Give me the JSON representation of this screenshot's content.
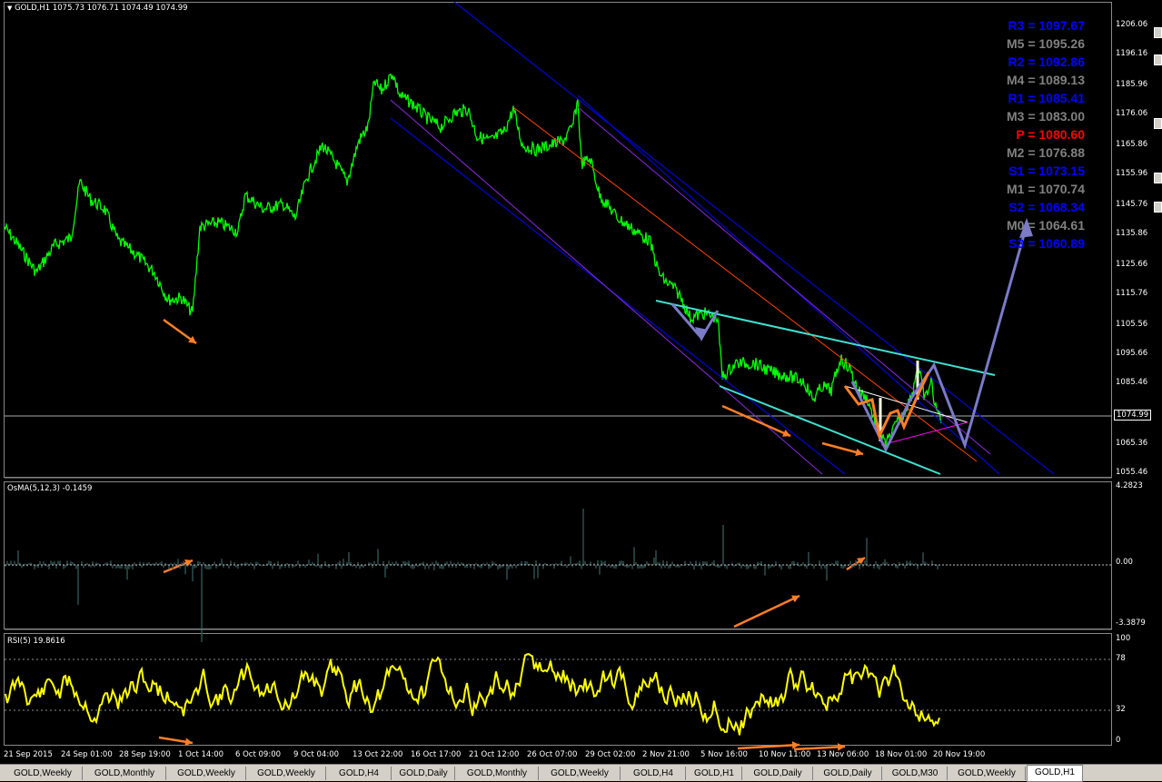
{
  "price_pane": {
    "title": "GOLD,H1  1075.73 1076.71 1074.49 1074.99",
    "current_price": "1074.99",
    "y_labels": [
      "1206.06",
      "1196.16",
      "1185.96",
      "1176.06",
      "1165.86",
      "1155.96",
      "1145.76",
      "1135.86",
      "1125.66",
      "1115.76",
      "1105.56",
      "1095.66",
      "1085.46",
      "1065.36",
      "1055.46"
    ],
    "pivots": [
      {
        "label": "R3 = 1097.67",
        "color": "#0000ff"
      },
      {
        "label": "M5 = 1095.26",
        "color": "#808080"
      },
      {
        "label": "R2 = 1092.86",
        "color": "#0000ff"
      },
      {
        "label": "M4 = 1089.13",
        "color": "#808080"
      },
      {
        "label": "R1 = 1085.41",
        "color": "#0000ff"
      },
      {
        "label": "M3 = 1083.00",
        "color": "#808080"
      },
      {
        "label": "P   = 1080.60",
        "color": "#ff0000"
      },
      {
        "label": "M2 = 1076.88",
        "color": "#808080"
      },
      {
        "label": "S1 = 1073.15",
        "color": "#0000ff"
      },
      {
        "label": "M1 = 1070.74",
        "color": "#808080"
      },
      {
        "label": "S2 = 1068.34",
        "color": "#0000ff"
      },
      {
        "label": "M0 = 1064.61",
        "color": "#808080"
      },
      {
        "label": "S3 = 1060.89",
        "color": "#0000ff"
      }
    ]
  },
  "osma_pane": {
    "title": "OsMA(5,12,3) -0.1459",
    "y_labels": [
      "4.2823",
      "0.00",
      "-3.3879"
    ]
  },
  "rsi_pane": {
    "title": "RSI(5) 19.8616",
    "y_labels": [
      "100",
      "78",
      "32",
      "0"
    ]
  },
  "x_labels": [
    "21 Sep 2015",
    "24 Sep 01:00",
    "28 Sep 19:00",
    "1 Oct 14:00",
    "6 Oct 09:00",
    "9 Oct 04:00",
    "13 Oct 22:00",
    "16 Oct 17:00",
    "21 Oct 12:00",
    "26 Oct 07:00",
    "29 Oct 02:00",
    "2 Nov 21:00",
    "5 Nov 16:00",
    "10 Nov 11:00",
    "13 Nov 06:00",
    "18 Nov 01:00",
    "20 Nov 19:00"
  ],
  "tabs": [
    "GOLD,Weekly",
    "GOLD,Monthly",
    "GOLD,Weekly",
    "GOLD,Weekly",
    "GOLD,H4",
    "GOLD,Daily",
    "GOLD,Monthly",
    "GOLD,Weekly",
    "GOLD,H4",
    "GOLD,H1",
    "GOLD,Daily",
    "GOLD,Daily",
    "GOLD,M30",
    "GOLD,Weekly",
    "GOLD,H1"
  ],
  "active_tab": 14,
  "colors": {
    "price_line": "#00ff00",
    "rsi_line": "#ffff00",
    "osma_hist": "#2f4f4f",
    "arrow": "#ff7f27",
    "channel": "#0000ff",
    "wedge": "#40e0d0",
    "forecast": "#7b7bc8"
  }
}
